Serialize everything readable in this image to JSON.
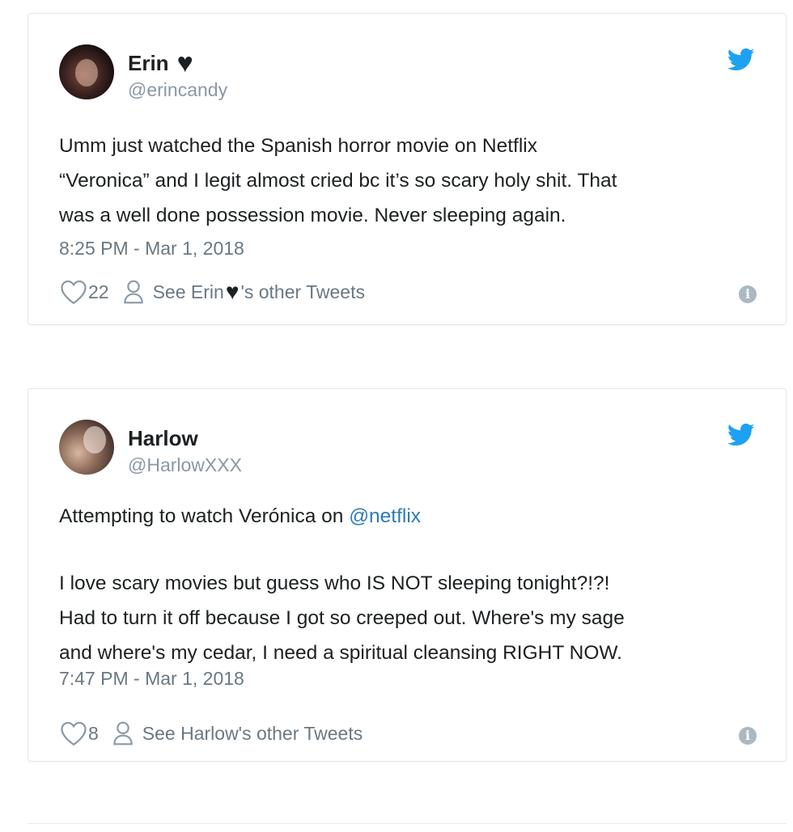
{
  "tweets": [
    {
      "display_name": "Erin",
      "name_emoji": "♥",
      "handle": "@erincandy",
      "text_lines": [
        "Umm just watched the Spanish horror movie on Netflix",
        "“Veronica” and I legit almost cried bc it’s so scary holy shit. That",
        "was a well done possession movie. Never sleeping again."
      ],
      "timestamp": "8:25 PM - Mar 1, 2018",
      "likes": "22",
      "see_tweets_prefix": "See Erin ",
      "see_tweets_suffix": "'s other Tweets"
    },
    {
      "display_name": "Harlow",
      "handle": "@HarlowXXX",
      "text_first_prefix": "Attempting to watch Verónica on ",
      "text_mention": "@netflix",
      "text_lines": [
        "I love scary movies but guess who IS NOT sleeping tonight?!?!",
        "Had to turn it off because I got so creeped out. Where's my sage",
        "and where's my cedar, I need a spiritual cleansing RIGHT NOW."
      ],
      "timestamp": "7:47 PM - Mar 1, 2018",
      "likes": "8",
      "see_tweets_label": "See Harlow's other Tweets"
    }
  ],
  "icons": {
    "twitter_bird": "twitter-bird-icon",
    "like": "heart-outline-icon",
    "profile": "person-icon",
    "info": "info-icon"
  },
  "colors": {
    "twitter_blue": "#1da1f2",
    "mention_link": "#2b7bb9",
    "meta_gray": "#697882",
    "border": "#e1e8ed"
  },
  "info_glyph": "i"
}
